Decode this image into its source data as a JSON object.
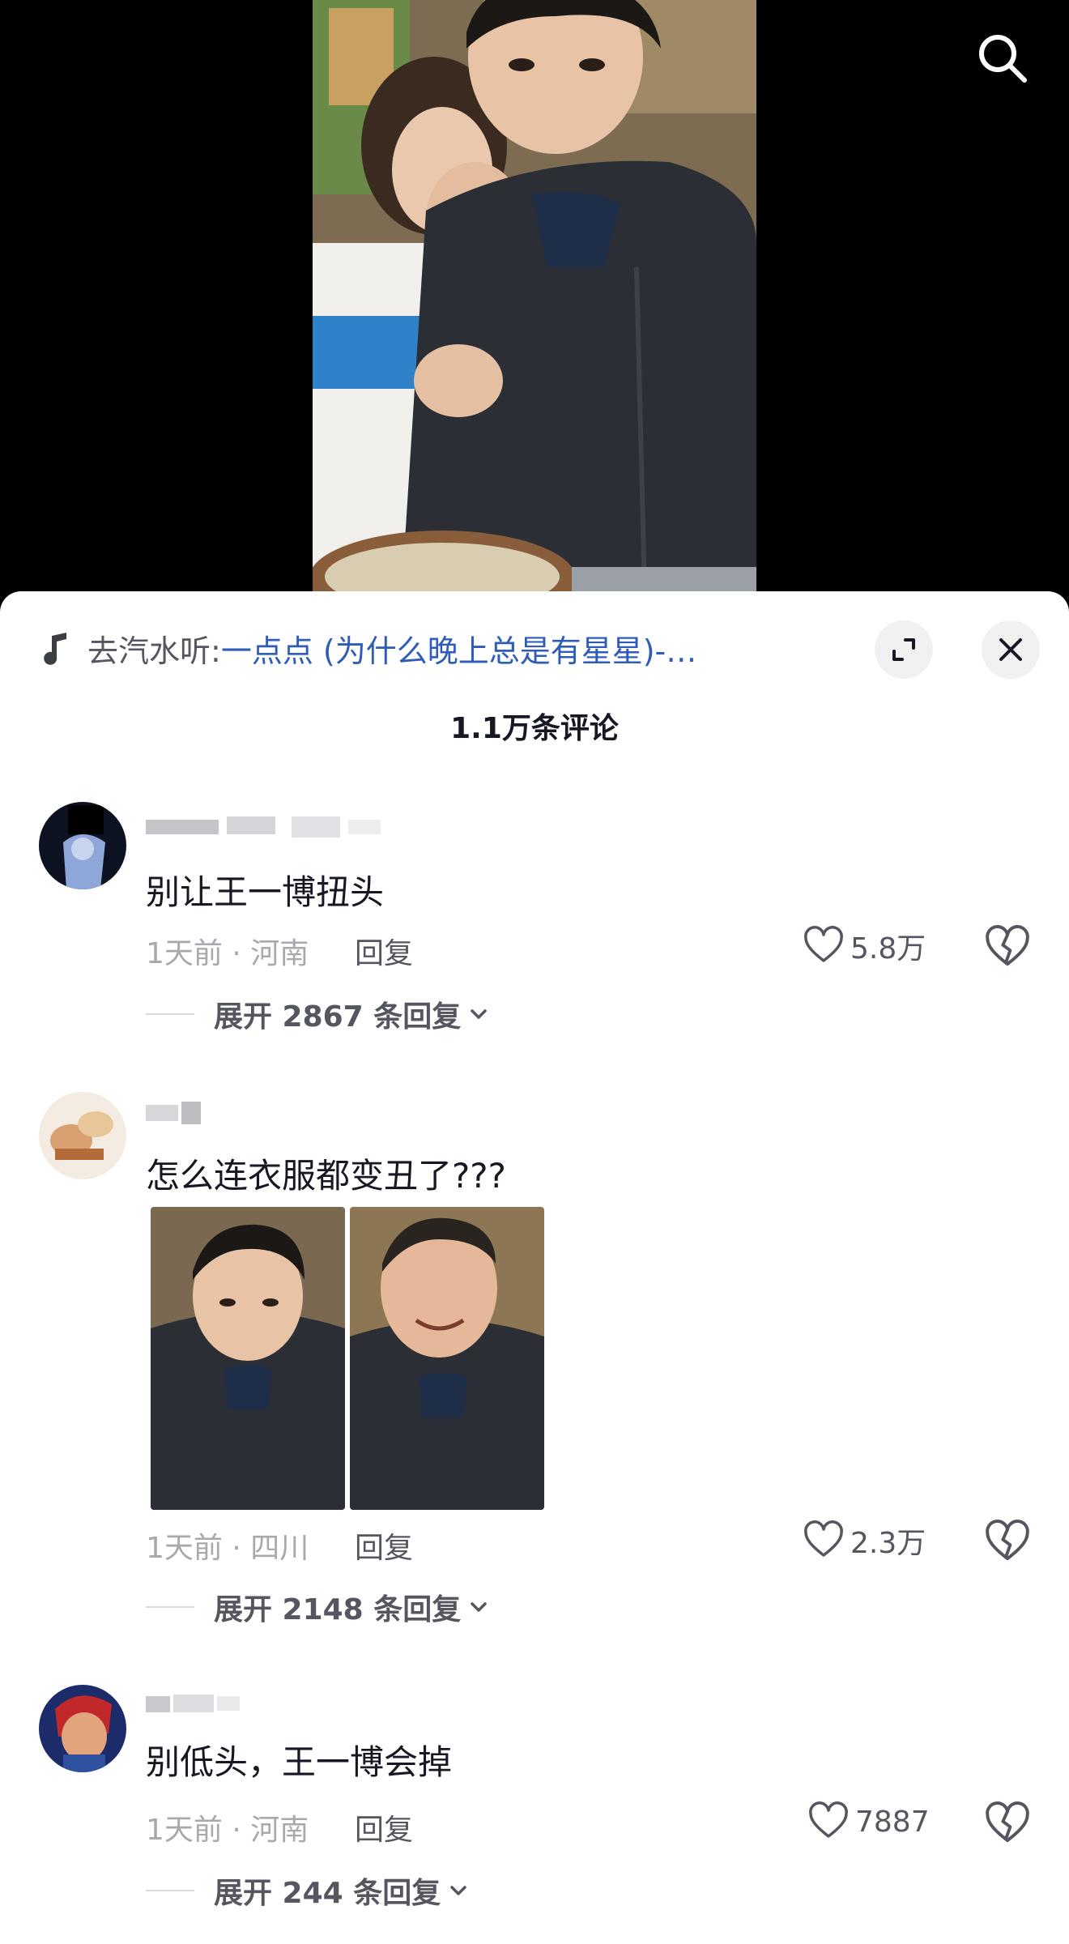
{
  "music": {
    "prefix": "去汽水听:",
    "title": "一点点 (为什么晚上总是有星星)-…"
  },
  "comments_count": "1.1万条评论",
  "comments": [
    {
      "text": "别让王一博扭头",
      "time_location": "1天前 · 河南",
      "reply_label": "回复",
      "likes": "5.8万",
      "expand_label": "展开 2867 条回复"
    },
    {
      "text": "怎么连衣服都变丑了???",
      "time_location": "1天前 · 四川",
      "reply_label": "回复",
      "likes": "2.3万",
      "expand_label": "展开 2148 条回复"
    },
    {
      "text": "别低头，王一博会掉",
      "time_location": "1天前 · 河南",
      "reply_label": "回复",
      "likes": "7887",
      "expand_label": "展开 244 条回复"
    }
  ],
  "colors": {
    "accent_link": "#2e5cb8",
    "text_primary": "#161823",
    "text_secondary": "#545660",
    "text_muted": "#a8a9ae"
  },
  "icons": [
    "search-icon",
    "music-note-icon",
    "expand-icon",
    "close-icon",
    "heart-icon",
    "broken-heart-icon",
    "chevron-down-icon"
  ]
}
